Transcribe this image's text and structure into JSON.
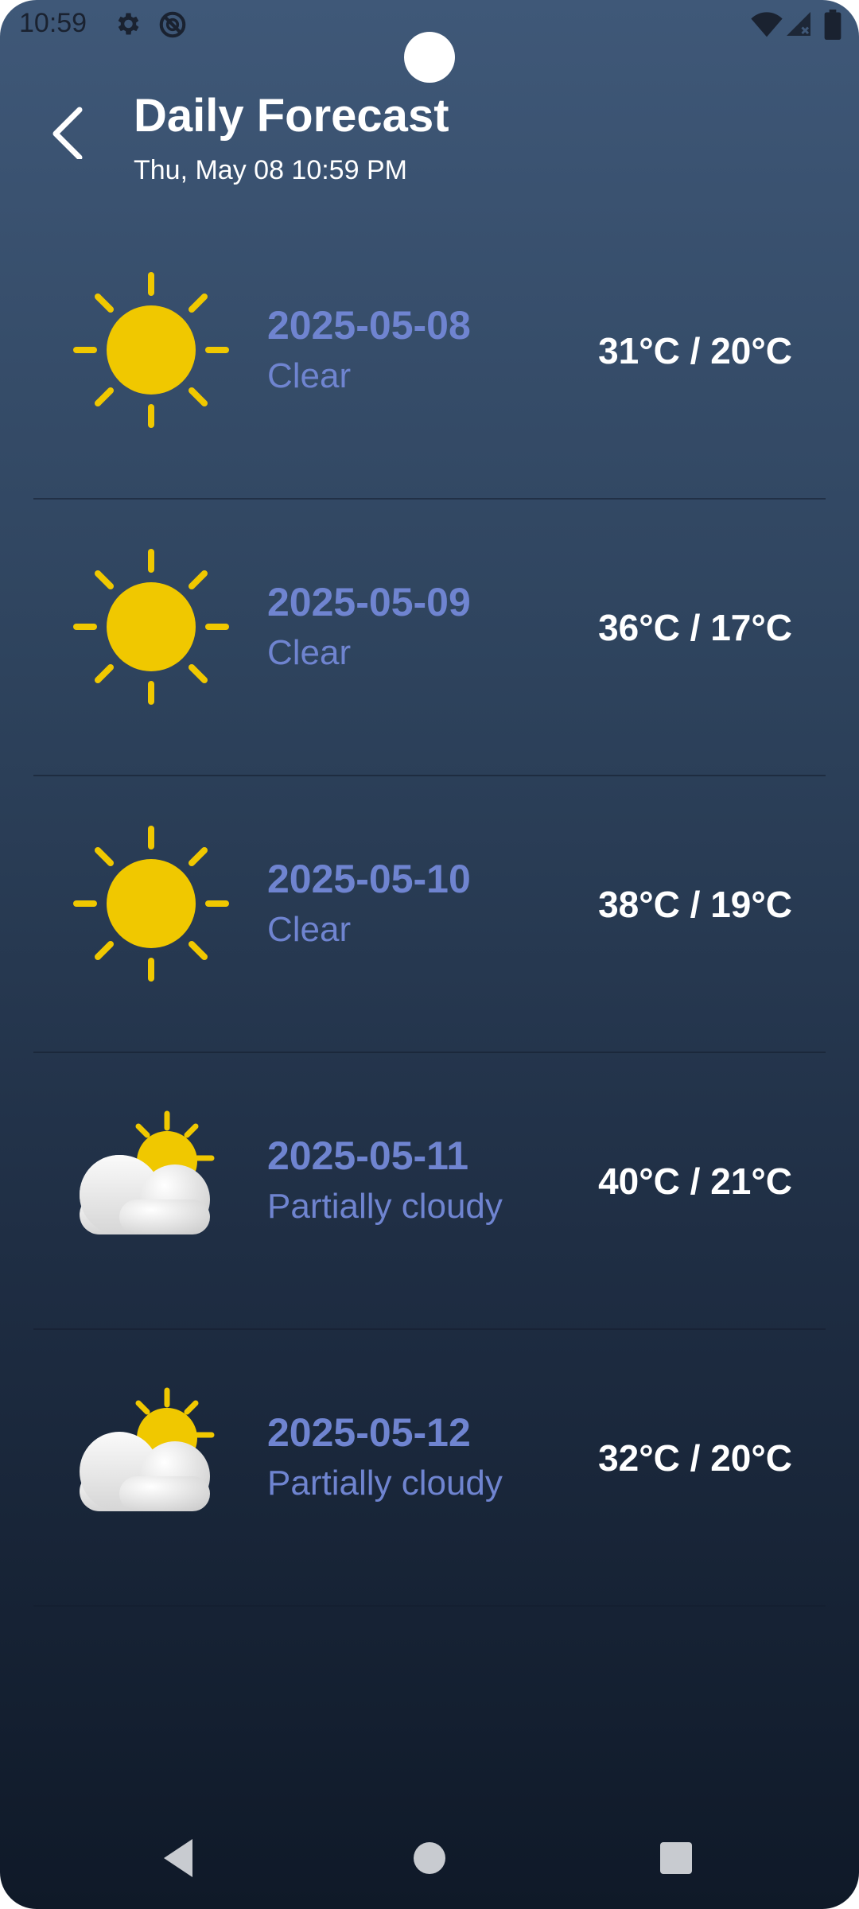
{
  "status_bar": {
    "time": "10:59",
    "icons_left": [
      "gear-icon",
      "do-not-disturb-icon"
    ],
    "icons_right": [
      "wifi-icon",
      "signal-icon",
      "battery-icon"
    ]
  },
  "header": {
    "title": "Daily Forecast",
    "subtitle": "Thu, May 08 10:59 PM"
  },
  "forecast": [
    {
      "date": "2025-05-08",
      "condition": "Clear",
      "temps": "31°C / 20°C",
      "icon": "sun-icon"
    },
    {
      "date": "2025-05-09",
      "condition": "Clear",
      "temps": "36°C / 17°C",
      "icon": "sun-icon"
    },
    {
      "date": "2025-05-10",
      "condition": "Clear",
      "temps": "38°C / 19°C",
      "icon": "sun-icon"
    },
    {
      "date": "2025-05-11",
      "condition": "Partially cloudy",
      "temps": "40°C / 21°C",
      "icon": "partly-cloudy-icon"
    },
    {
      "date": "2025-05-12",
      "condition": "Partially cloudy",
      "temps": "32°C / 20°C",
      "icon": "partly-cloudy-icon"
    }
  ],
  "colors": {
    "accent_text": "#6f84d0",
    "sun": "#f0c800",
    "background_top": "#3f5878",
    "background_bottom": "#0f1928"
  },
  "nav_bar": {
    "buttons": [
      "back-nav-icon",
      "home-nav-icon",
      "recents-nav-icon"
    ]
  }
}
